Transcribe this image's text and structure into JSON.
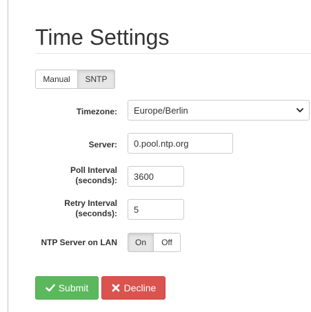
{
  "page": {
    "title": "Time Settings"
  },
  "mode": {
    "options": [
      "Manual",
      "SNTP"
    ],
    "selected": "SNTP"
  },
  "form": {
    "timezone": {
      "label": "Timezone:",
      "value": "Europe/Berlin"
    },
    "server": {
      "label": "Server:",
      "value": "0.pool.ntp.org"
    },
    "poll_interval": {
      "label_line1": "Poll Interval",
      "label_line2": "(seconds):",
      "value": "3600"
    },
    "retry_interval": {
      "label_line1": "Retry Interval",
      "label_line2": "(seconds):",
      "value": "5"
    },
    "ntp_server_lan": {
      "label": "NTP Server on LAN",
      "options": [
        "On",
        "Off"
      ],
      "selected": "On"
    }
  },
  "actions": {
    "submit_label": "Submit",
    "decline_label": "Decline"
  },
  "colors": {
    "submit": "#5cb85c",
    "decline": "#d9534f"
  },
  "icons": {
    "submit": "check-icon",
    "decline": "x-icon",
    "timezone_select": "chevron-down-icon"
  }
}
